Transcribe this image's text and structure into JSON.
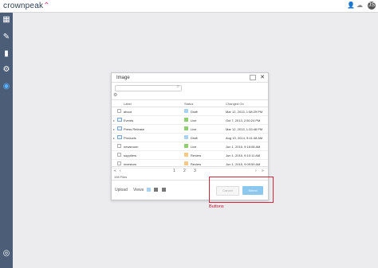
{
  "app": {
    "logo_main": "crownpeak",
    "avatar_initials": "JS"
  },
  "sidebar": {
    "icons": [
      "dashboard-icon",
      "edit-icon",
      "analytics-icon",
      "settings-icon",
      "cms-icon",
      "help-icon"
    ]
  },
  "dialog": {
    "title": "Image",
    "search_placeholder": "",
    "columns": {
      "label": "Label",
      "status": "Status",
      "changed_on": "Changed On"
    },
    "rows": [
      {
        "name": "about",
        "type": "file",
        "status": "Draft",
        "status_color": "#a9d3f2",
        "date": "Mar 12, 2013, 1:58:29 PM"
      },
      {
        "name": "Events",
        "type": "folder",
        "status": "Live",
        "status_color": "#8ed070",
        "date": "Oct 7, 2013, 2:50:24 PM"
      },
      {
        "name": "Press Release",
        "type": "folder",
        "status": "Live",
        "status_color": "#8ed070",
        "date": "Mar 12, 2013, 1:33:48 PM"
      },
      {
        "name": "Products",
        "type": "folder",
        "status": "Draft",
        "status_color": "#a9d3f2",
        "date": "Aug 19, 2014, 9:41:48 AM"
      },
      {
        "name": "newsroom",
        "type": "file",
        "status": "Live",
        "status_color": "#8ed070",
        "date": "Jun 1, 2015, 9:16:08 AM"
      },
      {
        "name": "suppliers",
        "type": "file",
        "status": "Review",
        "status_color": "#f6c987",
        "date": "Jun 1, 2015, 9:10:11 AM"
      },
      {
        "name": "investors",
        "type": "file",
        "status": "Review",
        "status_color": "#f6c987",
        "date": "Jun 1, 2015, 9:09:59 AM"
      }
    ],
    "pager": {
      "first": "«",
      "prev": "‹",
      "p1": "1",
      "p2": "2",
      "p3": "3",
      "next": "›",
      "last": "»"
    },
    "file_count": "198 Files",
    "upload_label": "Upload",
    "views_label": "Views",
    "cancel_label": "Cancel",
    "select_label": "Select"
  },
  "annotation": {
    "label": "Buttons",
    "color": "#d2263c"
  }
}
